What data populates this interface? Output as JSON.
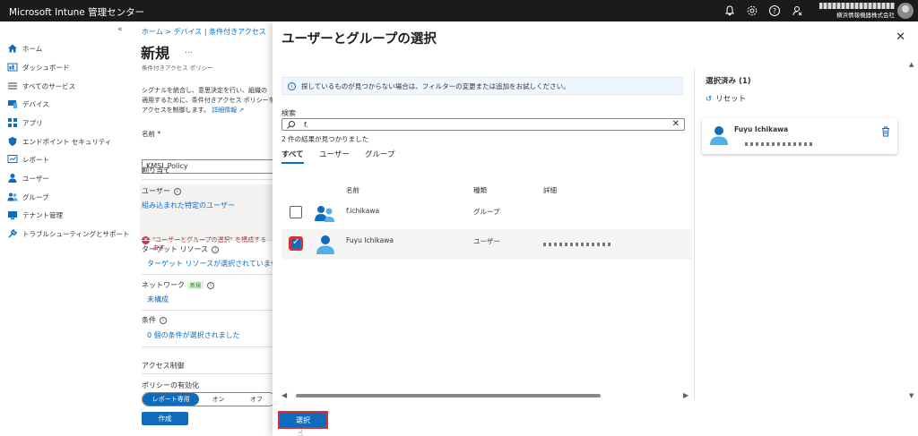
{
  "topbar": {
    "title": "Microsoft Intune 管理センター",
    "org": "横浜情報機器株式会社",
    "icons": [
      "bell-icon",
      "gear-icon",
      "help-icon",
      "feedback-icon"
    ]
  },
  "nav": {
    "collapse": "«",
    "items": [
      {
        "label": "ホーム",
        "icon": "home-icon"
      },
      {
        "label": "ダッシュボード",
        "icon": "dashboard-icon"
      },
      {
        "label": "すべてのサービス",
        "icon": "list-icon"
      },
      {
        "label": "デバイス",
        "icon": "device-icon"
      },
      {
        "label": "アプリ",
        "icon": "apps-icon"
      },
      {
        "label": "エンドポイント セキュリティ",
        "icon": "shield-icon"
      },
      {
        "label": "レポート",
        "icon": "report-icon"
      },
      {
        "label": "ユーザー",
        "icon": "user-icon"
      },
      {
        "label": "グループ",
        "icon": "group-icon"
      },
      {
        "label": "テナント管理",
        "icon": "tenant-icon"
      },
      {
        "label": "トラブルシューティングとサポート",
        "icon": "wrench-icon"
      }
    ]
  },
  "blade": {
    "breadcrumb": "ホーム > デバイス | 条件付きアクセス",
    "title": "新規",
    "ellipsis": "...",
    "subtitle": "条件付きアクセス ポリシー",
    "description_1": "シグナルを統合し、意思決定を行い、組織の",
    "description_2": "適用するために、条件付きアクセス ポリシーを",
    "description_3": "アクセスを制御します。",
    "learn_more": "詳細情報",
    "name_label": "名前 *",
    "name_value": "KMSI_Policy",
    "assignments": "割り当て",
    "users_label": "ユーザー",
    "users_link": "組み込まれた特定のユーザー",
    "error_1": "\"ユーザーとグループの選択\" を構成する",
    "error_2": "ます",
    "target_label": "ターゲット リソース",
    "target_link": "ターゲット リソースが選択されていません",
    "network_label": "ネットワーク",
    "network_badge": "新規",
    "network_link": "未構成",
    "conditions_label": "条件",
    "conditions_link": "0 個の条件が選択されました",
    "access_control": "アクセス制御",
    "enable_label": "ポリシーの有効化",
    "toggle": [
      "レポート専用",
      "オン",
      "オフ"
    ],
    "create": "作成"
  },
  "panel": {
    "title": "ユーザーとグループの選択",
    "info": "探しているものが見つからない場合は、フィルターの変更または追加をお試しください。",
    "search_label": "検索",
    "search_value": "f.",
    "result_count": "2 件の結果が見つかりました",
    "tabs": [
      "すべて",
      "ユーザー",
      "グループ"
    ],
    "columns": [
      "名前",
      "種類",
      "詳細"
    ],
    "rows": [
      {
        "name": "f.ichikawa",
        "type": "グループ",
        "checked": false,
        "icon": "group-icon"
      },
      {
        "name": "Fuyu Ichikawa",
        "type": "ユーザー",
        "checked": true,
        "icon": "user-icon"
      }
    ],
    "select_button": "選択",
    "selected_title": "選択済み (1)",
    "reset": "リセット",
    "selected_items": [
      {
        "name": "Fuyu Ichikawa"
      }
    ]
  }
}
